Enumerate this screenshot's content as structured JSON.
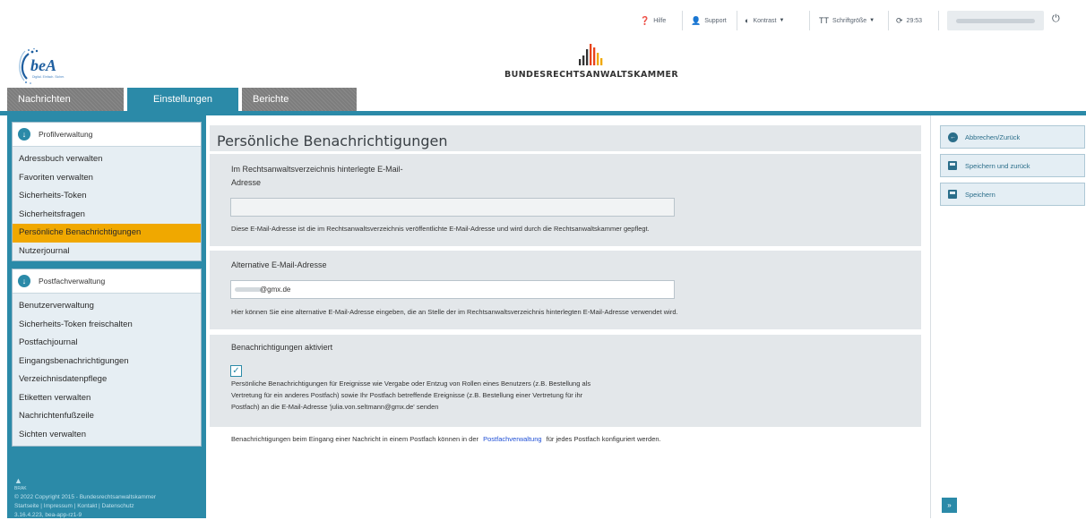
{
  "topbar": {
    "help": "Hilfe",
    "support": "Support",
    "contrast": "Kontrast",
    "font_size": "Schriftgröße",
    "timer": "29:53"
  },
  "header": {
    "bea_logo_text": "beA",
    "bea_logo_sub": "Digital. Einfach. Sicher.",
    "brak_name": "BUNDESRECHTSANWALTSKAMMER"
  },
  "nav": {
    "tabs": [
      {
        "label": "Nachrichten"
      },
      {
        "label": "Einstellungen"
      },
      {
        "label": "Berichte"
      }
    ]
  },
  "sidebar": {
    "sections": [
      {
        "title": "Profilverwaltung",
        "items": [
          "Adressbuch verwalten",
          "Favoriten verwalten",
          "Sicherheits-Token",
          "Sicherheitsfragen",
          "Persönliche Benachrichtigungen",
          "Nutzerjournal"
        ]
      },
      {
        "title": "Postfachverwaltung",
        "items": [
          "Benutzerverwaltung",
          "Sicherheits-Token freischalten",
          "Postfachjournal",
          "Eingangsbenachrichtigungen",
          "Verzeichnisdatenpflege",
          "Etiketten verwalten",
          "Nachrichtenfußzeile",
          "Sichten verwalten"
        ]
      }
    ],
    "footer": {
      "brak": "BRAK",
      "copyright": "© 2022 Copyright 2015 - Bundesrechtsanwaltskammer",
      "links": "Startseite | Impressum | Kontakt | Datenschutz",
      "version": "3.16.4.223, bea-app-rz1-9"
    }
  },
  "main": {
    "title": "Persönliche Benachrichtigungen",
    "rav_email": {
      "label_line1": "Im Rechtsanwaltsverzeichnis hinterlegte E-Mail-",
      "label_line2": "Adresse",
      "value": "",
      "help": "Diese E-Mail-Adresse ist die im Rechtsanwaltsverzeichnis veröffentlichte E-Mail-Adresse und wird durch die Rechtsanwaltskammer gepflegt."
    },
    "alt_email": {
      "label": "Alternative E-Mail-Adresse",
      "value": "@gmx.de",
      "help": "Hier können Sie eine alternative E-Mail-Adresse eingeben, die an Stelle der im Rechtsanwaltsverzeichnis hinterlegten E-Mail-Adresse verwendet wird."
    },
    "notifications": {
      "label": "Benachrichtigungen aktiviert",
      "checked": true,
      "text_line1": "Persönliche Benachrichtigungen für Ereignisse wie Vergabe oder Entzug von Rollen eines Benutzers (z.B. Bestellung als",
      "text_line2": "Vertretung für ein anderes Postfach) sowie Ihr Postfach betreffende Ereignisse (z.B. Bestellung einer Vertretung für ihr",
      "text_line3": "Postfach) an die E-Mail-Adresse 'julia.von.seltmann@gmx.de' senden"
    },
    "note": {
      "before": "Benachrichtigungen beim Eingang einer Nachricht in einem Postfach können in der",
      "link": "Postfachverwaltung",
      "after": "für jedes Postfach konfiguriert werden."
    }
  },
  "actions": {
    "cancel": "Abbrechen/Zurück",
    "save_back": "Speichern und zurück",
    "save": "Speichern",
    "expand": "»"
  },
  "colors": {
    "accent": "#2b8aa8",
    "active": "#f0a800",
    "section_bg": "#e3e7ea"
  }
}
